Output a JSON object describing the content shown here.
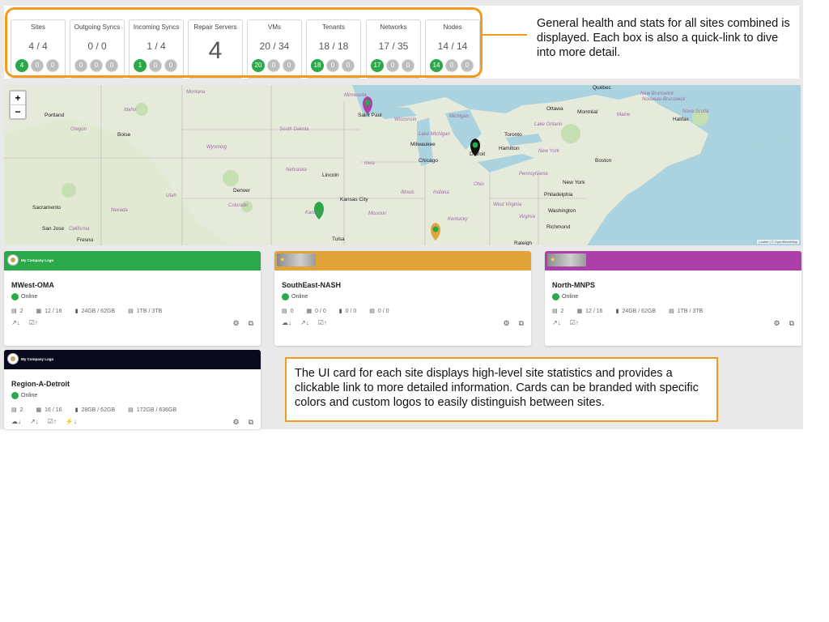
{
  "stats": [
    {
      "label": "Sites",
      "value": "4 / 4",
      "counts": [
        "4",
        "0",
        "0"
      ],
      "first_green": true,
      "big": false
    },
    {
      "label": "Outgoing Syncs",
      "value": "0 / 0",
      "counts": [
        "0",
        "0",
        "0"
      ],
      "first_green": false,
      "big": false
    },
    {
      "label": "Incoming Syncs",
      "value": "1 / 4",
      "counts": [
        "1",
        "0",
        "0"
      ],
      "first_green": true,
      "big": false
    },
    {
      "label": "Repair Servers",
      "value": "4",
      "counts": [],
      "first_green": false,
      "big": true
    },
    {
      "label": "VMs",
      "value": "20 / 34",
      "counts": [
        "20",
        "0",
        "0"
      ],
      "first_green": true,
      "big": false
    },
    {
      "label": "Tenants",
      "value": "18 / 18",
      "counts": [
        "18",
        "0",
        "0"
      ],
      "first_green": true,
      "big": false
    },
    {
      "label": "Networks",
      "value": "17 / 35",
      "counts": [
        "17",
        "0",
        "0"
      ],
      "first_green": true,
      "big": false
    },
    {
      "label": "Nodes",
      "value": "14 / 14",
      "counts": [
        "14",
        "0",
        "0"
      ],
      "first_green": true,
      "big": false
    }
  ],
  "stats_callout": "General health and stats for all sites combined is displayed.  Each box is also a quick-link to dive into more detail.",
  "map": {
    "zoom_in": "+",
    "zoom_out": "−",
    "attribution": "Leaflet | © OpenStreetMap",
    "labels": [
      "Montana",
      "Idaho",
      "Portland",
      "Oregon",
      "Boise",
      "Wyoming",
      "South Dakota",
      "Nebraska",
      "Minnesota",
      "Saint Paul",
      "Wisconsin",
      "Michigan",
      "Lake Michigan",
      "Milwaukee",
      "Chicago",
      "Iowa",
      "Illinois",
      "Indiana",
      "Ohio",
      "Detroit",
      "Toronto",
      "Hamilton",
      "Lake Ontario",
      "New York",
      "Ottawa",
      "Montréal",
      "Québec",
      "Maine",
      "New Brunswick",
      "Nouveau-Brunswick",
      "Nova Scotia",
      "Halifax",
      "Boston",
      "Pennsylvania",
      "New York",
      "Philadelphia",
      "Washington",
      "Virginia",
      "Richmond",
      "West Virginia",
      "Kentucky",
      "Missouri",
      "Kansas City",
      "Kansas",
      "Utah",
      "Colorado",
      "Denver",
      "Lincoln",
      "Nevada",
      "Sacramento",
      "San Jose",
      "California",
      "Fresno",
      "Tulsa",
      "Raleigh"
    ]
  },
  "cards": [
    {
      "name": "MWest-OMA",
      "status": "Online",
      "header_color": "#2aa84a",
      "logo_type": "circle",
      "logo_text": "My Company Logo",
      "servers": "2",
      "cpu": "12 / 16",
      "memory": "24GB / 62GB",
      "storage": "1TB / 3TB",
      "bottom_icons": [
        "↗↓",
        "☑↑"
      ]
    },
    {
      "name": "SouthEast-NASH",
      "status": "Online",
      "header_color": "#e1a43b",
      "logo_type": "rect",
      "logo_text": "",
      "servers": "0",
      "cpu": "0 / 0",
      "memory": "0 / 0",
      "storage": "0 / 0",
      "bottom_icons": [
        "☁↓",
        "↗↓",
        "☑↑"
      ]
    },
    {
      "name": "North-MNPS",
      "status": "Online",
      "header_color": "#ad3fa8",
      "logo_type": "rect",
      "logo_text": "",
      "servers": "2",
      "cpu": "12 / 16",
      "memory": "24GB / 62GB",
      "storage": "1TB / 3TB",
      "bottom_icons": [
        "↗↓",
        "☑↑"
      ]
    },
    {
      "name": "Region-A-Detroit",
      "status": "Online",
      "header_color": "#0a0a1e",
      "logo_type": "circle",
      "logo_text": "My Company Logo",
      "servers": "2",
      "cpu": "16 / 16",
      "memory": "28GB / 62GB",
      "storage": "172GB / 636GB",
      "bottom_icons": [
        "☁↓",
        "↗↓",
        "☑↑",
        "⚡↓"
      ]
    }
  ],
  "card_callout": "The UI card for each site displays high-level site statistics and provides a clickable link to more detailed information. Cards can be branded with specific colors and custom logos to easily distinguish between sites.",
  "colors": {
    "accent": "#f29a1e",
    "online": "#2aa84a",
    "pin_green": "#2aa84a",
    "pin_purple": "#ad3fa8",
    "pin_black": "#111111",
    "pin_orange": "#e1a43b"
  },
  "icons": {
    "servers": "server-icon",
    "cpu": "cpu-icon",
    "memory": "memory-icon",
    "storage": "storage-icon",
    "settings": "gear-icon",
    "open": "external-link-icon"
  }
}
